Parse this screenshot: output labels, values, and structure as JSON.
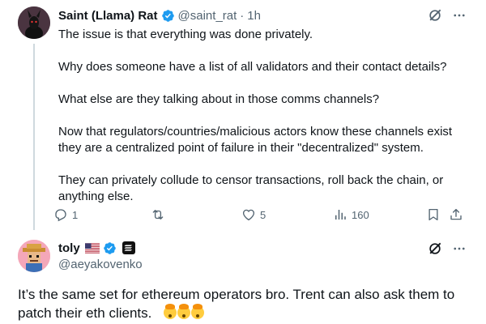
{
  "tweet1": {
    "author_name": "Saint (Llama) Rat",
    "handle": "@saint_rat",
    "separator": "·",
    "time": "1h",
    "paragraphs": [
      "The issue is that everything was done privately.",
      "Why does someone have a list of all validators and their contact details?",
      "What else are they talking about in those comms channels?",
      "Now that regulators/countries/malicious actors know these channels exist they are a centralized point of failure in their \"decentralized\" system.",
      "They can privately collude to censor transactions, roll back the chain, or anything else."
    ],
    "actions": {
      "reply_count": "1",
      "repost_count": "",
      "like_count": "5",
      "views_count": "160"
    }
  },
  "tweet2": {
    "author_name": "toly",
    "handle": "@aeyakovenko",
    "text": "It’s the same set for ethereum operators bro.  Trent can also ask them to patch their eth clients."
  },
  "colors": {
    "text_primary": "#0f1419",
    "text_secondary": "#536471",
    "verified_blue": "#1d9bf0",
    "thread_line": "#cfd9de"
  },
  "icons": {
    "verified": "verified-badge-icon",
    "grok": "grok-icon",
    "more": "more-dots-icon",
    "reply": "reply-icon",
    "repost": "repost-icon",
    "like": "like-icon",
    "views": "views-icon",
    "bookmark": "bookmark-icon",
    "share": "share-icon"
  }
}
